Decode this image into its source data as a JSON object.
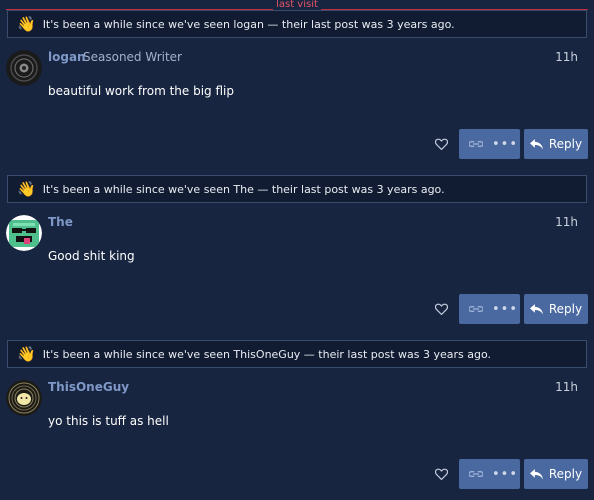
{
  "last_visit_label": "last visit",
  "posts": [
    {
      "notice": "It's been a while since we've seen logan — their last post was 3 years ago.",
      "username": "logan",
      "user_title": "Seasoned Writer",
      "time": "11h",
      "body": "beautiful work from the big flip",
      "reply_label": "Reply"
    },
    {
      "notice": "It's been a while since we've seen The — their last post was 3 years ago.",
      "username": "The",
      "user_title": "",
      "time": "11h",
      "body": "Good shit king",
      "reply_label": "Reply"
    },
    {
      "notice": "It's been a while since we've seen ThisOneGuy — their last post was 3 years ago.",
      "username": "ThisOneGuy",
      "user_title": "",
      "time": "11h",
      "body": "yo this is tuff as hell",
      "reply_label": "Reply"
    }
  ],
  "icons": {
    "wave": "waving-hand-icon",
    "like": "heart-icon",
    "link": "link-icon",
    "more": "ellipsis-icon",
    "reply": "reply-arrow-icon"
  },
  "colors": {
    "background": "#172540",
    "accent_button": "#4a69a0",
    "username": "#7f98c7",
    "last_visit_line": "#c22b3d"
  }
}
